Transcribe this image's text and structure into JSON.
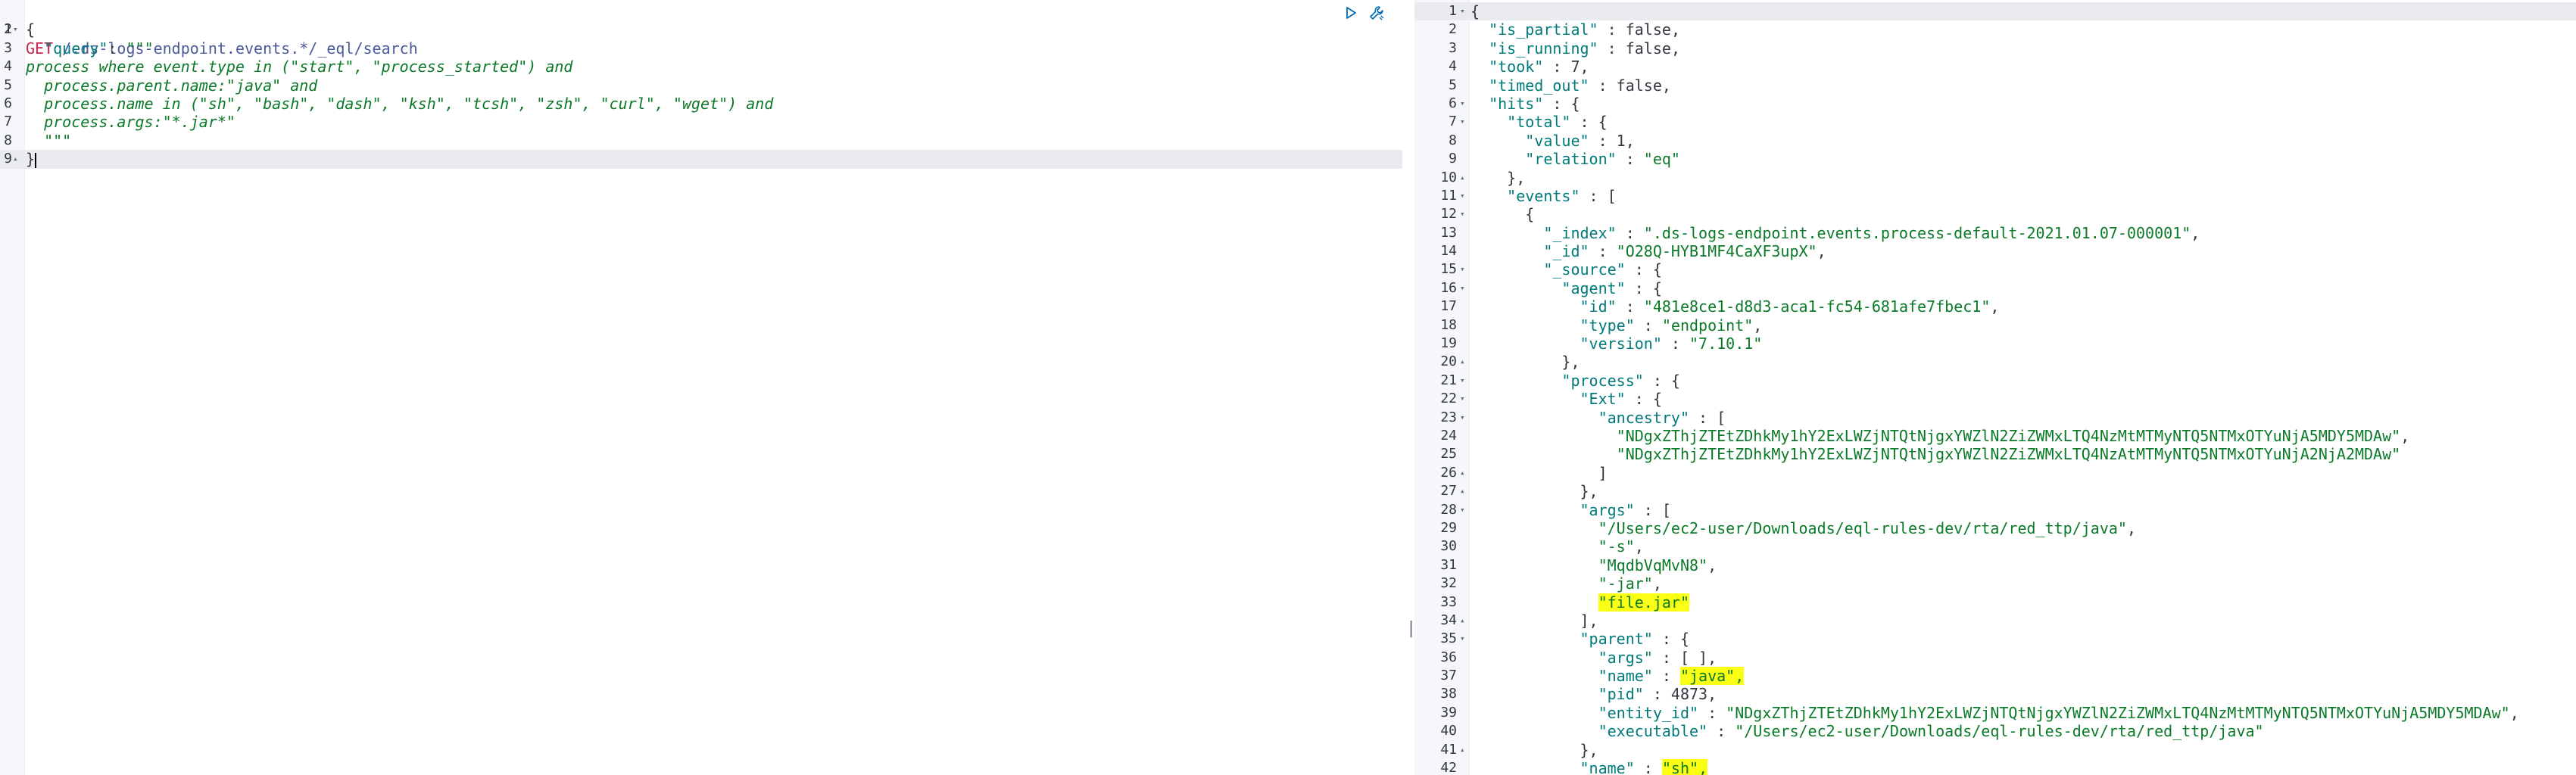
{
  "request": {
    "method": "GET",
    "path": " /.ds-logs-endpoint.events.*/_eql/search",
    "lines": [
      [
        [
          "punc",
          "{"
        ]
      ],
      [
        [
          "punc",
          "  "
        ],
        [
          "key",
          "\"query\""
        ],
        [
          "punc",
          ": "
        ],
        [
          "str",
          "\"\"\""
        ]
      ],
      [
        [
          "eql",
          "process where event.type in (\"start\", \"process_started\") and"
        ]
      ],
      [
        [
          "eql",
          "  process.parent.name:\"java\" and"
        ]
      ],
      [
        [
          "eql",
          "  process.name in (\"sh\", \"bash\", \"dash\", \"ksh\", \"tcsh\", \"zsh\", \"curl\", \"wget\") and"
        ]
      ],
      [
        [
          "eql",
          "  process.args:\"*.jar*\""
        ]
      ],
      [
        [
          "str",
          "  \"\"\""
        ]
      ],
      [
        [
          "punc",
          "}"
        ]
      ]
    ],
    "line_numbers": [
      "1",
      "2",
      "3",
      "4",
      "5",
      "6",
      "7",
      "8",
      "9"
    ],
    "fold_lines": [
      "2",
      "9"
    ]
  },
  "toolbar": {
    "run_icon": "play-icon",
    "settings_icon": "wrench-icon"
  },
  "response": {
    "lines": [
      {
        "n": "1",
        "fold": "▾",
        "t": [
          [
            "punc",
            "{"
          ]
        ]
      },
      {
        "n": "2",
        "t": [
          [
            "punc",
            "  "
          ],
          [
            "key",
            "\"is_partial\""
          ],
          [
            "punc",
            " : "
          ],
          [
            "bool",
            "false"
          ],
          [
            "punc",
            ","
          ]
        ]
      },
      {
        "n": "3",
        "t": [
          [
            "punc",
            "  "
          ],
          [
            "key",
            "\"is_running\""
          ],
          [
            "punc",
            " : "
          ],
          [
            "bool",
            "false"
          ],
          [
            "punc",
            ","
          ]
        ]
      },
      {
        "n": "4",
        "t": [
          [
            "punc",
            "  "
          ],
          [
            "key",
            "\"took\""
          ],
          [
            "punc",
            " : "
          ],
          [
            "num",
            "7"
          ],
          [
            "punc",
            ","
          ]
        ]
      },
      {
        "n": "5",
        "t": [
          [
            "punc",
            "  "
          ],
          [
            "key",
            "\"timed_out\""
          ],
          [
            "punc",
            " : "
          ],
          [
            "bool",
            "false"
          ],
          [
            "punc",
            ","
          ]
        ]
      },
      {
        "n": "6",
        "fold": "▾",
        "t": [
          [
            "punc",
            "  "
          ],
          [
            "key",
            "\"hits\""
          ],
          [
            "punc",
            " : {"
          ]
        ]
      },
      {
        "n": "7",
        "fold": "▾",
        "t": [
          [
            "punc",
            "    "
          ],
          [
            "key",
            "\"total\""
          ],
          [
            "punc",
            " : {"
          ]
        ]
      },
      {
        "n": "8",
        "t": [
          [
            "punc",
            "      "
          ],
          [
            "key",
            "\"value\""
          ],
          [
            "punc",
            " : "
          ],
          [
            "num",
            "1"
          ],
          [
            "punc",
            ","
          ]
        ]
      },
      {
        "n": "9",
        "t": [
          [
            "punc",
            "      "
          ],
          [
            "key",
            "\"relation\""
          ],
          [
            "punc",
            " : "
          ],
          [
            "str",
            "\"eq\""
          ]
        ]
      },
      {
        "n": "10",
        "fold": "▴",
        "t": [
          [
            "punc",
            "    },"
          ]
        ]
      },
      {
        "n": "11",
        "fold": "▾",
        "t": [
          [
            "punc",
            "    "
          ],
          [
            "key",
            "\"events\""
          ],
          [
            "punc",
            " : ["
          ]
        ]
      },
      {
        "n": "12",
        "fold": "▾",
        "t": [
          [
            "punc",
            "      {"
          ]
        ]
      },
      {
        "n": "13",
        "t": [
          [
            "punc",
            "        "
          ],
          [
            "key",
            "\"_index\""
          ],
          [
            "punc",
            " : "
          ],
          [
            "str",
            "\".ds-logs-endpoint.events.process-default-2021.01.07-000001\""
          ],
          [
            "punc",
            ","
          ]
        ]
      },
      {
        "n": "14",
        "t": [
          [
            "punc",
            "        "
          ],
          [
            "key",
            "\"_id\""
          ],
          [
            "punc",
            " : "
          ],
          [
            "str",
            "\"O28Q-HYB1MF4CaXF3upX\""
          ],
          [
            "punc",
            ","
          ]
        ]
      },
      {
        "n": "15",
        "fold": "▾",
        "t": [
          [
            "punc",
            "        "
          ],
          [
            "key",
            "\"_source\""
          ],
          [
            "punc",
            " : {"
          ]
        ]
      },
      {
        "n": "16",
        "fold": "▾",
        "t": [
          [
            "punc",
            "          "
          ],
          [
            "key",
            "\"agent\""
          ],
          [
            "punc",
            " : {"
          ]
        ]
      },
      {
        "n": "17",
        "t": [
          [
            "punc",
            "            "
          ],
          [
            "key",
            "\"id\""
          ],
          [
            "punc",
            " : "
          ],
          [
            "str",
            "\"481e8ce1-d8d3-aca1-fc54-681afe7fbec1\""
          ],
          [
            "punc",
            ","
          ]
        ]
      },
      {
        "n": "18",
        "t": [
          [
            "punc",
            "            "
          ],
          [
            "key",
            "\"type\""
          ],
          [
            "punc",
            " : "
          ],
          [
            "str",
            "\"endpoint\""
          ],
          [
            "punc",
            ","
          ]
        ]
      },
      {
        "n": "19",
        "t": [
          [
            "punc",
            "            "
          ],
          [
            "key",
            "\"version\""
          ],
          [
            "punc",
            " : "
          ],
          [
            "str",
            "\"7.10.1\""
          ]
        ]
      },
      {
        "n": "20",
        "fold": "▴",
        "t": [
          [
            "punc",
            "          },"
          ]
        ]
      },
      {
        "n": "21",
        "fold": "▾",
        "t": [
          [
            "punc",
            "          "
          ],
          [
            "key",
            "\"process\""
          ],
          [
            "punc",
            " : {"
          ]
        ]
      },
      {
        "n": "22",
        "fold": "▾",
        "t": [
          [
            "punc",
            "            "
          ],
          [
            "key",
            "\"Ext\""
          ],
          [
            "punc",
            " : {"
          ]
        ]
      },
      {
        "n": "23",
        "fold": "▾",
        "t": [
          [
            "punc",
            "              "
          ],
          [
            "key",
            "\"ancestry\""
          ],
          [
            "punc",
            " : ["
          ]
        ]
      },
      {
        "n": "24",
        "t": [
          [
            "punc",
            "                "
          ],
          [
            "str",
            "\"NDgxZThjZTEtZDhkMy1hY2ExLWZjNTQtNjgxYWZlN2ZiZWMxLTQ4NzMtMTMyNTQ5NTMxOTYuNjA5MDY5MDAw\""
          ],
          [
            "punc",
            ","
          ]
        ]
      },
      {
        "n": "25",
        "t": [
          [
            "punc",
            "                "
          ],
          [
            "str",
            "\"NDgxZThjZTEtZDhkMy1hY2ExLWZjNTQtNjgxYWZlN2ZiZWMxLTQ4NzAtMTMyNTQ5NTMxOTYuNjA2NjA2MDAw\""
          ]
        ]
      },
      {
        "n": "26",
        "fold": "▴",
        "t": [
          [
            "punc",
            "              ]"
          ]
        ]
      },
      {
        "n": "27",
        "fold": "▴",
        "t": [
          [
            "punc",
            "            },"
          ]
        ]
      },
      {
        "n": "28",
        "fold": "▾",
        "t": [
          [
            "punc",
            "            "
          ],
          [
            "key",
            "\"args\""
          ],
          [
            "punc",
            " : ["
          ]
        ]
      },
      {
        "n": "29",
        "t": [
          [
            "punc",
            "              "
          ],
          [
            "str",
            "\"/Users/ec2-user/Downloads/eql-rules-dev/rta/red_ttp/java\""
          ],
          [
            "punc",
            ","
          ]
        ]
      },
      {
        "n": "30",
        "t": [
          [
            "punc",
            "              "
          ],
          [
            "str",
            "\"-s\""
          ],
          [
            "punc",
            ","
          ]
        ]
      },
      {
        "n": "31",
        "t": [
          [
            "punc",
            "              "
          ],
          [
            "str",
            "\"MqdbVqMvN8\""
          ],
          [
            "punc",
            ","
          ]
        ]
      },
      {
        "n": "32",
        "t": [
          [
            "punc",
            "              "
          ],
          [
            "str",
            "\"-jar\""
          ],
          [
            "punc",
            ","
          ]
        ]
      },
      {
        "n": "33",
        "t": [
          [
            "punc",
            "              "
          ],
          [
            "hlstr",
            "\"file.jar\""
          ]
        ]
      },
      {
        "n": "34",
        "fold": "▴",
        "t": [
          [
            "punc",
            "            ],"
          ]
        ]
      },
      {
        "n": "35",
        "fold": "▾",
        "t": [
          [
            "punc",
            "            "
          ],
          [
            "key",
            "\"parent\""
          ],
          [
            "punc",
            " : {"
          ]
        ]
      },
      {
        "n": "36",
        "t": [
          [
            "punc",
            "              "
          ],
          [
            "key",
            "\"args\""
          ],
          [
            "punc",
            " : [ ],"
          ]
        ]
      },
      {
        "n": "37",
        "t": [
          [
            "punc",
            "              "
          ],
          [
            "key",
            "\"name\""
          ],
          [
            "punc",
            " : "
          ],
          [
            "hlstr",
            "\"java\","
          ]
        ]
      },
      {
        "n": "38",
        "t": [
          [
            "punc",
            "              "
          ],
          [
            "key",
            "\"pid\""
          ],
          [
            "punc",
            " : "
          ],
          [
            "num",
            "4873"
          ],
          [
            "punc",
            ","
          ]
        ]
      },
      {
        "n": "39",
        "t": [
          [
            "punc",
            "              "
          ],
          [
            "key",
            "\"entity_id\""
          ],
          [
            "punc",
            " : "
          ],
          [
            "str",
            "\"NDgxZThjZTEtZDhkMy1hY2ExLWZjNTQtNjgxYWZlN2ZiZWMxLTQ4NzMtMTMyNTQ5NTMxOTYuNjA5MDY5MDAw\""
          ],
          [
            "punc",
            ","
          ]
        ]
      },
      {
        "n": "40",
        "t": [
          [
            "punc",
            "              "
          ],
          [
            "key",
            "\"executable\""
          ],
          [
            "punc",
            " : "
          ],
          [
            "str",
            "\"/Users/ec2-user/Downloads/eql-rules-dev/rta/red_ttp/java\""
          ]
        ]
      },
      {
        "n": "41",
        "fold": "▴",
        "t": [
          [
            "punc",
            "            },"
          ]
        ]
      },
      {
        "n": "42",
        "t": [
          [
            "punc",
            "            "
          ],
          [
            "key",
            "\"name\""
          ],
          [
            "punc",
            " : "
          ],
          [
            "hlstr",
            "\"sh\","
          ]
        ]
      }
    ]
  },
  "resizer_glyph": "||"
}
